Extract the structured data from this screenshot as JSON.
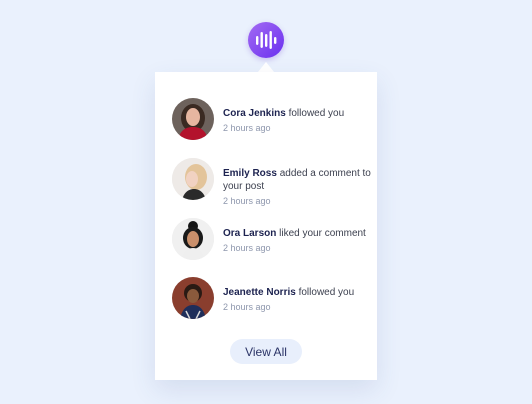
{
  "app": {
    "logo_icon": "sound-wave-icon"
  },
  "notifications": [
    {
      "name": "Cora Jenkins",
      "action": "followed you",
      "time": "2 hours ago",
      "avatar_icon": "avatar-photo"
    },
    {
      "name": "Emily Ross",
      "action": "added a comment to your post",
      "time": "2 hours ago",
      "avatar_icon": "avatar-photo"
    },
    {
      "name": "Ora Larson",
      "action": "liked your comment",
      "time": "2 hours ago",
      "avatar_icon": "avatar-photo"
    },
    {
      "name": "Jeanette Norris",
      "action": "followed you",
      "time": "2 hours ago",
      "avatar_icon": "avatar-photo"
    }
  ],
  "footer": {
    "view_all_label": "View All"
  },
  "colors": {
    "accent_start": "#a36bf2",
    "accent_end": "#6a2ff0",
    "name_text": "#1d2350",
    "time_text": "#8e97ad",
    "button_bg": "#e8effc"
  }
}
